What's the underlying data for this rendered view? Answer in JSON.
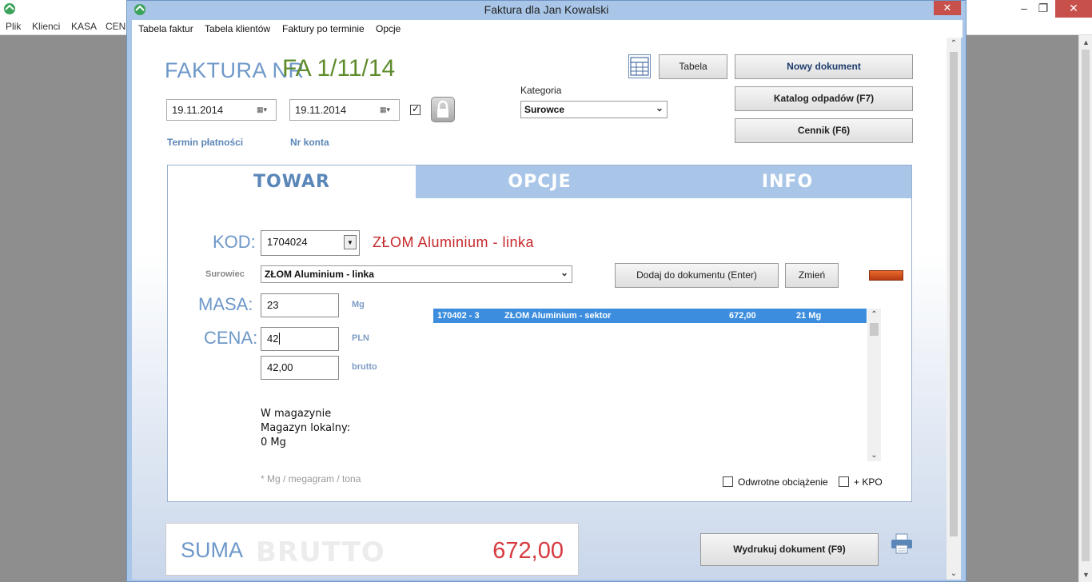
{
  "bg_app": {
    "menu": [
      "Plik",
      "Klienci",
      "KASA",
      "CEN"
    ]
  },
  "window": {
    "title": "Faktura dla Jan Kowalski",
    "close_glyph": "✕"
  },
  "menu": [
    "Tabela faktur",
    "Tabela klientów",
    "Faktury po terminie",
    "Opcje"
  ],
  "header": {
    "faktura_label": "FAKTURA NR",
    "faktura_nr": "FA 1/11/14",
    "date1": "19.11.2014",
    "date2": "19.11.2014",
    "checkbox_checked": true,
    "termin_label": "Termin płatności",
    "konto_label": "Nr konta",
    "kategoria_label": "Kategoria",
    "kategoria_value": "Surowce"
  },
  "buttons": {
    "tabela": "Tabela",
    "nowy": "Nowy dokument",
    "katalog": "Katalog odpadów (F7)",
    "cennik": "Cennik (F6)",
    "dodaj": "Dodaj do dokumentu (Enter)",
    "zmien": "Zmień",
    "wydrukuj": "Wydrukuj dokument (F9)"
  },
  "tabs": [
    "TOWAR",
    "OPCJE",
    "INFO"
  ],
  "form": {
    "kod_label": "KOD:",
    "kod_value": "1704024",
    "kod_name": "ZŁOM Aluminium - linka",
    "surowiec_label": "Surowiec",
    "surowiec_value": "ZŁOM Aluminium - linka",
    "masa_label": "MASA:",
    "masa_value": "23",
    "masa_unit": "Mg",
    "cena_label": "CENA:",
    "cena_value": "42",
    "cena_unit": "PLN",
    "brutto_value": "42,00",
    "brutto_unit": "brutto",
    "accent_color": "#d9531e"
  },
  "items": [
    {
      "code": "170402 - 3",
      "name": "ZŁOM Aluminium - sektor",
      "price": "672,00",
      "qty": "21 Mg"
    }
  ],
  "stock": {
    "line1": "W magazynie",
    "line2": "Magazyn lokalny:",
    "line3": "0 Mg"
  },
  "note": "* Mg / megagram / tona",
  "options": {
    "odwrotne": "Odwrotne obciążenie",
    "kpo": "+ KPO"
  },
  "suma": {
    "label": "SUMA",
    "brutto": "BRUTTO",
    "value": "672,00"
  }
}
